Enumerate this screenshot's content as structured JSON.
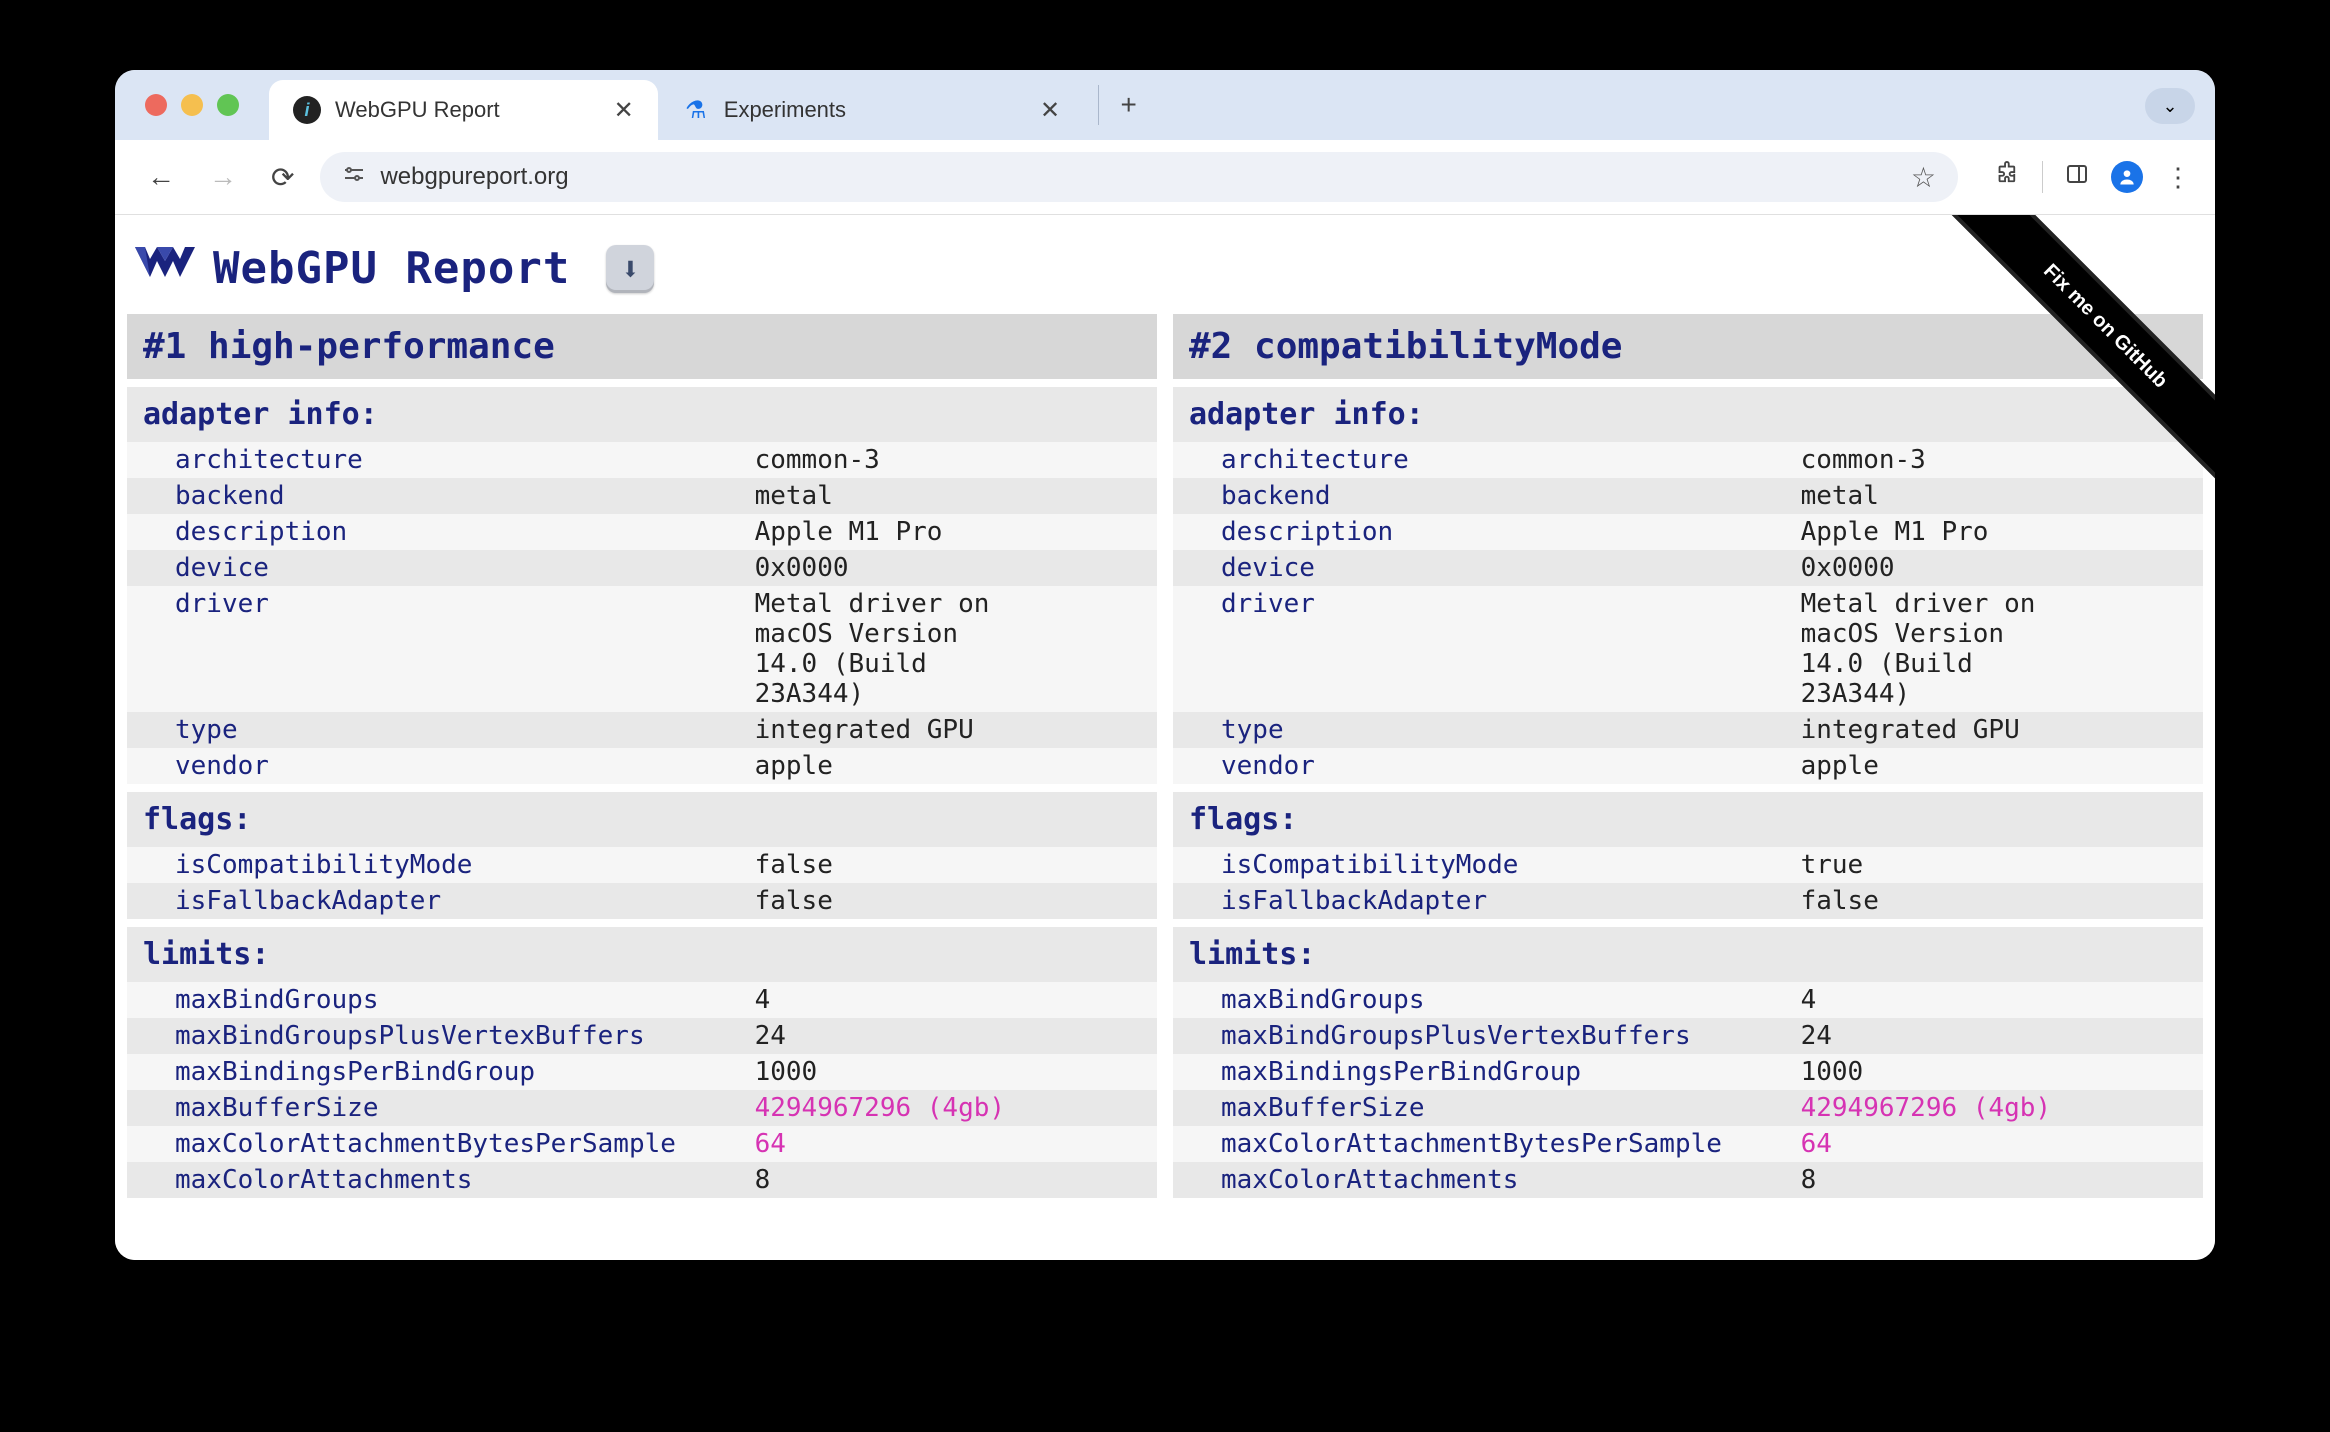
{
  "browser": {
    "tabs": [
      {
        "title": "WebGPU Report",
        "active": true
      },
      {
        "title": "Experiments",
        "active": false
      }
    ],
    "url": "webgpureport.org"
  },
  "page": {
    "title": "WebGPU Report",
    "ribbon": "Fix me on GitHub"
  },
  "adapters": [
    {
      "heading": "#1 high-performance",
      "sections": {
        "adapter_info_label": "adapter info:",
        "adapter_info": [
          {
            "k": "architecture",
            "v": "common-3"
          },
          {
            "k": "backend",
            "v": "metal"
          },
          {
            "k": "description",
            "v": "Apple M1 Pro"
          },
          {
            "k": "device",
            "v": "0x0000"
          },
          {
            "k": "driver",
            "v": "Metal driver on\nmacOS Version\n14.0 (Build\n23A344)"
          },
          {
            "k": "type",
            "v": "integrated GPU"
          },
          {
            "k": "vendor",
            "v": "apple"
          }
        ],
        "flags_label": "flags:",
        "flags": [
          {
            "k": "isCompatibilityMode",
            "v": "false"
          },
          {
            "k": "isFallbackAdapter",
            "v": "false"
          }
        ],
        "limits_label": "limits:",
        "limits": [
          {
            "k": "maxBindGroups",
            "v": "4"
          },
          {
            "k": "maxBindGroupsPlusVertexBuffers",
            "v": "24"
          },
          {
            "k": "maxBindingsPerBindGroup",
            "v": "1000"
          },
          {
            "k": "maxBufferSize",
            "v": "4294967296 (4gb)",
            "highlight": true
          },
          {
            "k": "maxColorAttachmentBytesPerSample",
            "v": "64",
            "highlight": true
          },
          {
            "k": "maxColorAttachments",
            "v": "8"
          }
        ]
      }
    },
    {
      "heading": "#2 compatibilityMode",
      "sections": {
        "adapter_info_label": "adapter info:",
        "adapter_info": [
          {
            "k": "architecture",
            "v": "common-3"
          },
          {
            "k": "backend",
            "v": "metal"
          },
          {
            "k": "description",
            "v": "Apple M1 Pro"
          },
          {
            "k": "device",
            "v": "0x0000"
          },
          {
            "k": "driver",
            "v": "Metal driver on\nmacOS Version\n14.0 (Build\n23A344)"
          },
          {
            "k": "type",
            "v": "integrated GPU"
          },
          {
            "k": "vendor",
            "v": "apple"
          }
        ],
        "flags_label": "flags:",
        "flags": [
          {
            "k": "isCompatibilityMode",
            "v": "true"
          },
          {
            "k": "isFallbackAdapter",
            "v": "false"
          }
        ],
        "limits_label": "limits:",
        "limits": [
          {
            "k": "maxBindGroups",
            "v": "4"
          },
          {
            "k": "maxBindGroupsPlusVertexBuffers",
            "v": "24"
          },
          {
            "k": "maxBindingsPerBindGroup",
            "v": "1000"
          },
          {
            "k": "maxBufferSize",
            "v": "4294967296 (4gb)",
            "highlight": true
          },
          {
            "k": "maxColorAttachmentBytesPerSample",
            "v": "64",
            "highlight": true
          },
          {
            "k": "maxColorAttachments",
            "v": "8"
          }
        ]
      }
    }
  ]
}
